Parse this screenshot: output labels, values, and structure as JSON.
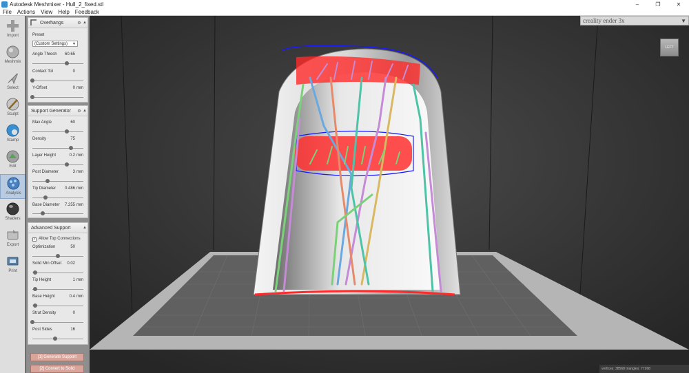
{
  "window": {
    "title": "Autodesk Meshmixer - Hull_2_fixed.stl",
    "controls": [
      "–",
      "❐",
      "✕"
    ]
  },
  "menu": [
    "File",
    "Actions",
    "View",
    "Help",
    "Feedback"
  ],
  "tools": [
    {
      "label": "Import",
      "icon": "import-icon",
      "color": "#9a9a9a"
    },
    {
      "label": "Meshmix",
      "icon": "meshmix-icon",
      "color": "#b8b8b8"
    },
    {
      "label": "Select",
      "icon": "select-icon",
      "color": "#a8a8a8"
    },
    {
      "label": "Sculpt",
      "icon": "sculpt-icon",
      "color": "#8a8a6a"
    },
    {
      "label": "Stamp",
      "icon": "stamp-icon",
      "color": "#3a8fd0"
    },
    {
      "label": "Edit",
      "icon": "edit-icon",
      "color": "#909090"
    },
    {
      "label": "Analysis",
      "icon": "analysis-icon",
      "color": "#4a7fc0"
    },
    {
      "label": "Shaders",
      "icon": "shaders-icon",
      "color": "#555555"
    },
    {
      "label": "Export",
      "icon": "export-icon",
      "color": "#a0a0a0"
    },
    {
      "label": "Print",
      "icon": "print-icon",
      "color": "#5a7fa0"
    }
  ],
  "overhangs": {
    "title": "Overhangs",
    "preset_label": "Preset",
    "preset_value": "(Custom Settings)",
    "angle_thresh": {
      "label": "Angle Thresh",
      "value": "60.65",
      "unit": "",
      "level": 0.67
    },
    "contact_tol": {
      "label": "Contact Tol",
      "value": "0",
      "unit": "",
      "level": 0.0
    },
    "y_offset": {
      "label": "Y-Offset",
      "value": "0",
      "unit": "mm",
      "level": 0.0
    }
  },
  "support_generator": {
    "title": "Support Generator",
    "max_angle": {
      "label": "Max Angle",
      "value": "60",
      "unit": "",
      "level": 0.67
    },
    "density": {
      "label": "Density",
      "value": "75",
      "unit": "",
      "level": 0.75
    },
    "layer_height": {
      "label": "Layer Height",
      "value": "0.2",
      "unit": "mm",
      "level": 0.67
    },
    "post_diameter": {
      "label": "Post Diameter",
      "value": "3",
      "unit": "mm",
      "level": 0.3
    },
    "tip_diameter": {
      "label": "Tip Diameter",
      "value": "0.486",
      "unit": "mm",
      "level": 0.25
    },
    "base_diameter": {
      "label": "Base Diameter",
      "value": "7.255",
      "unit": "mm",
      "level": 0.2
    }
  },
  "advanced_support": {
    "title": "Advanced Support",
    "allow_top_label": "Allow Top Connections",
    "allow_top_checked": true,
    "optimization": {
      "label": "Optimization",
      "value": "50",
      "unit": "",
      "level": 0.5
    },
    "solid_min_offset": {
      "label": "Solid Min Offset",
      "value": "0.02",
      "unit": "",
      "level": 0.05
    },
    "tip_height": {
      "label": "Tip Height",
      "value": "1",
      "unit": "mm",
      "level": 0.05
    },
    "base_height": {
      "label": "Base Height",
      "value": "0.4",
      "unit": "mm",
      "level": 0.05
    },
    "strut_density": {
      "label": "Strut Density",
      "value": "0",
      "unit": "",
      "level": 0.0
    },
    "post_sides": {
      "label": "Post Sides",
      "value": "16",
      "unit": "",
      "level": 0.45
    }
  },
  "buttons": {
    "generate": "[1] Generate Support",
    "convert": "[2] Convert to Solid"
  },
  "printer": "creality ender 3x",
  "view_cube": "LEFT",
  "status": "vertices: 38568 triangles: 77268",
  "colors": {
    "support_colors": [
      "#4fc3a8",
      "#7ad17a",
      "#c58bd6",
      "#e58a6a",
      "#6aa8e0",
      "#d8b860"
    ],
    "overhang": "#ff0000",
    "outline": "#1a1aff",
    "bed": "#6e6e6e"
  }
}
